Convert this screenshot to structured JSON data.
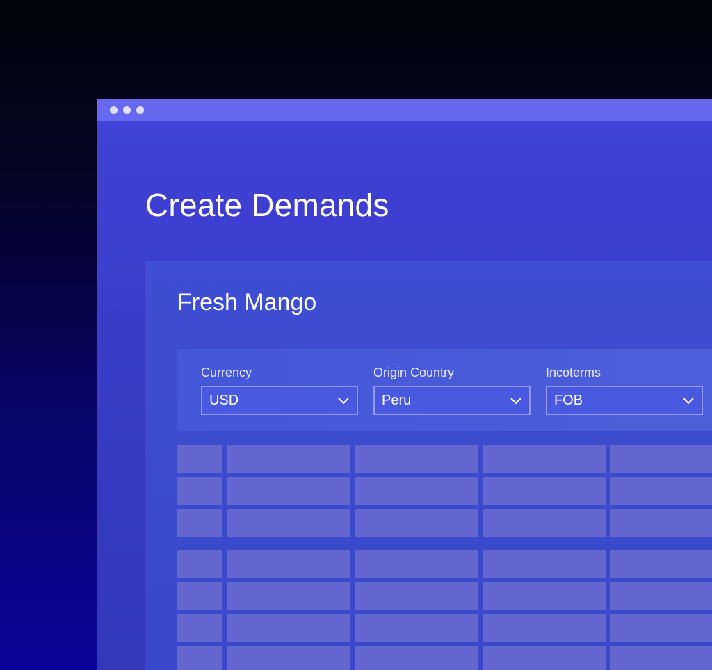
{
  "window": {
    "controls": [
      "dot",
      "dot",
      "dot"
    ]
  },
  "page": {
    "title": "Create Demands"
  },
  "card": {
    "title": "Fresh Mango",
    "filters": [
      {
        "label": "Currency",
        "value": "USD",
        "icon": "chevron-down-icon"
      },
      {
        "label": "Origin Country",
        "value": "Peru",
        "icon": "chevron-down-icon"
      },
      {
        "label": "Incoterms",
        "value": "FOB",
        "icon": "chevron-down-icon"
      }
    ]
  },
  "tables": {
    "group1_rows": 3,
    "group2_rows": 4,
    "columns": 5
  },
  "colors": {
    "titlebar": "#6668f0",
    "window": "#4242d8",
    "cell": "#6467cf",
    "select_border": "#8f99ff"
  }
}
